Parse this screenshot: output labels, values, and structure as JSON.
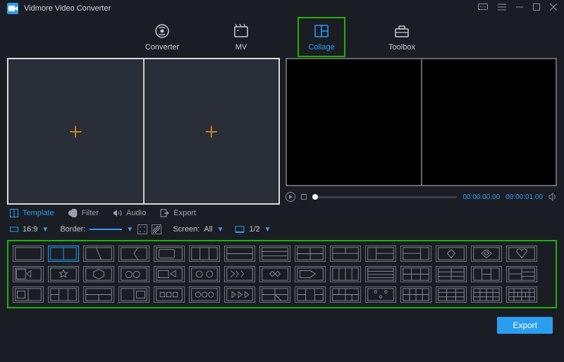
{
  "app_title": "Vidmore Video Converter",
  "main_tabs": {
    "converter": "Converter",
    "mv": "MV",
    "collage": "Collage",
    "toolbox": "Toolbox"
  },
  "left_tabs": {
    "template": "Template",
    "filter": "Filter",
    "audio": "Audio",
    "export": "Export"
  },
  "options": {
    "ratio_label": "16:9",
    "border_label": "Border:",
    "screen_label": "Screen:",
    "screen_value": "All",
    "page_label": "1/2"
  },
  "time": {
    "current": "00:00:00.00",
    "total": "00:00:01.00"
  },
  "footer": {
    "export": "Export"
  }
}
